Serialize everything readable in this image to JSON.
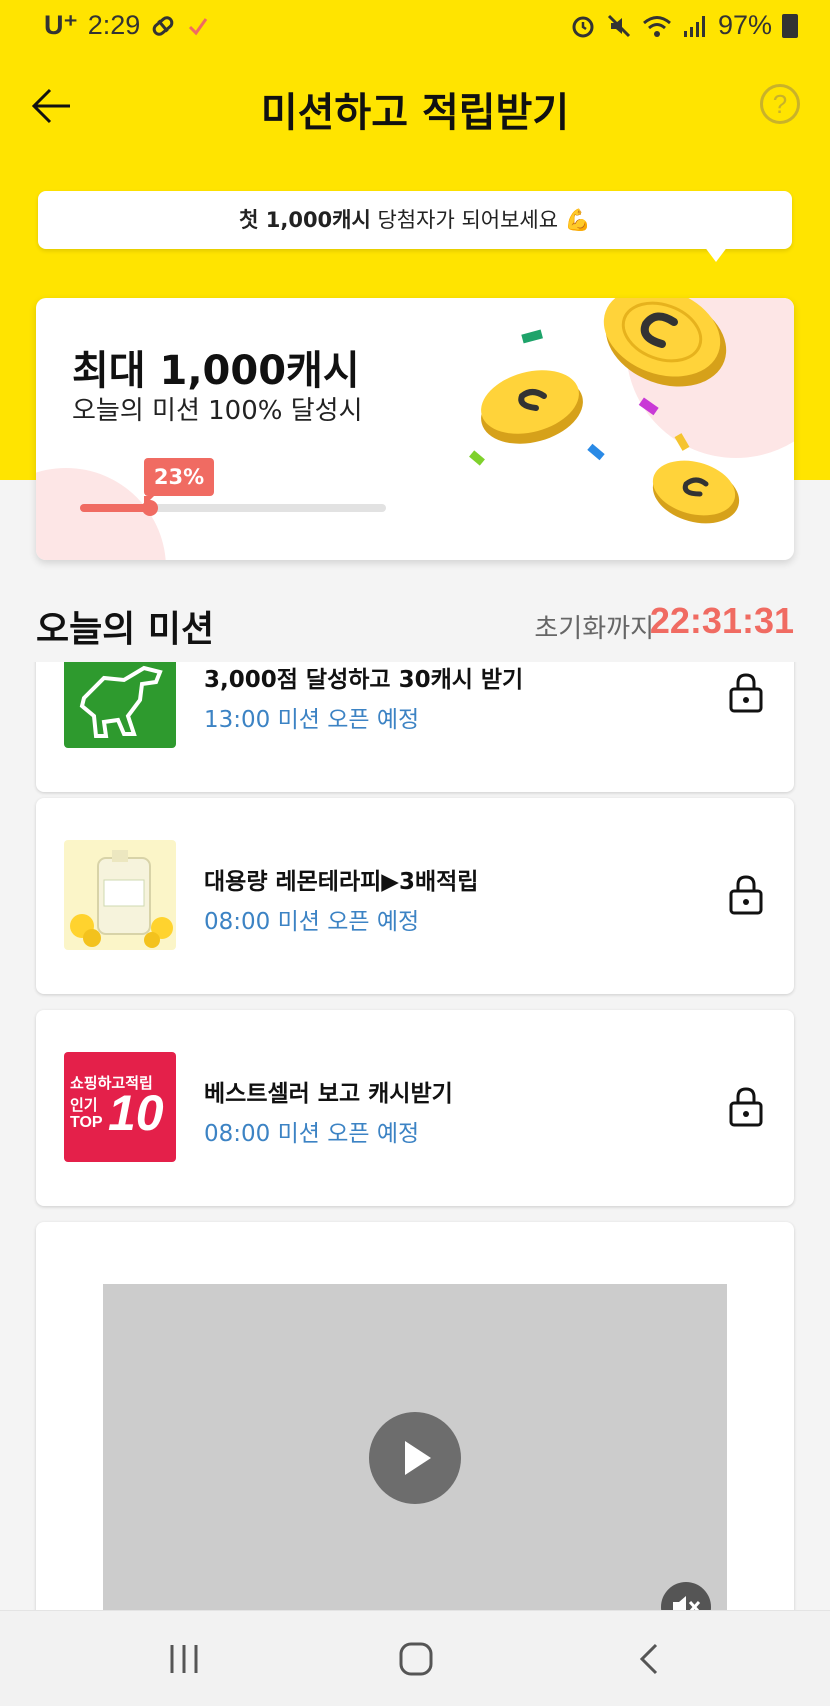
{
  "status_bar": {
    "carrier": "U⁺",
    "time": "2:29",
    "battery": "97%"
  },
  "header": {
    "title": "미션하고 적립받기",
    "help": "?"
  },
  "bubble": {
    "highlight": "첫 1,000캐시",
    "rest": " 당첨자가 되어보세요 💪"
  },
  "reward": {
    "title": "최대 1,000캐시",
    "subtitle": "오늘의 미션 100% 달성시",
    "progress_label": "23%",
    "progress": 0.23
  },
  "section": {
    "title": "오늘의 미션",
    "reset_label": "초기화까지",
    "reset_time": "22:31:31"
  },
  "missions": [
    {
      "name": "3,000점 달성하고 30캐시 받기",
      "time": "13:00 미션 오픈 예정",
      "thumb": "dinosaur-game"
    },
    {
      "name": "대용량 레몬테라피▶3배적립",
      "time": "08:00 미션 오픈 예정",
      "thumb": "lemon-detergent"
    },
    {
      "name": "베스트셀러 보고 캐시받기",
      "time": "08:00 미션 오픈 예정",
      "thumb_lines": [
        "쇼핑하고적립",
        "인기",
        "TOP",
        "10"
      ]
    }
  ],
  "colors": {
    "brand_yellow": "#ffe400",
    "accent_red": "#f06b62",
    "time_blue": "#3c83c4"
  }
}
